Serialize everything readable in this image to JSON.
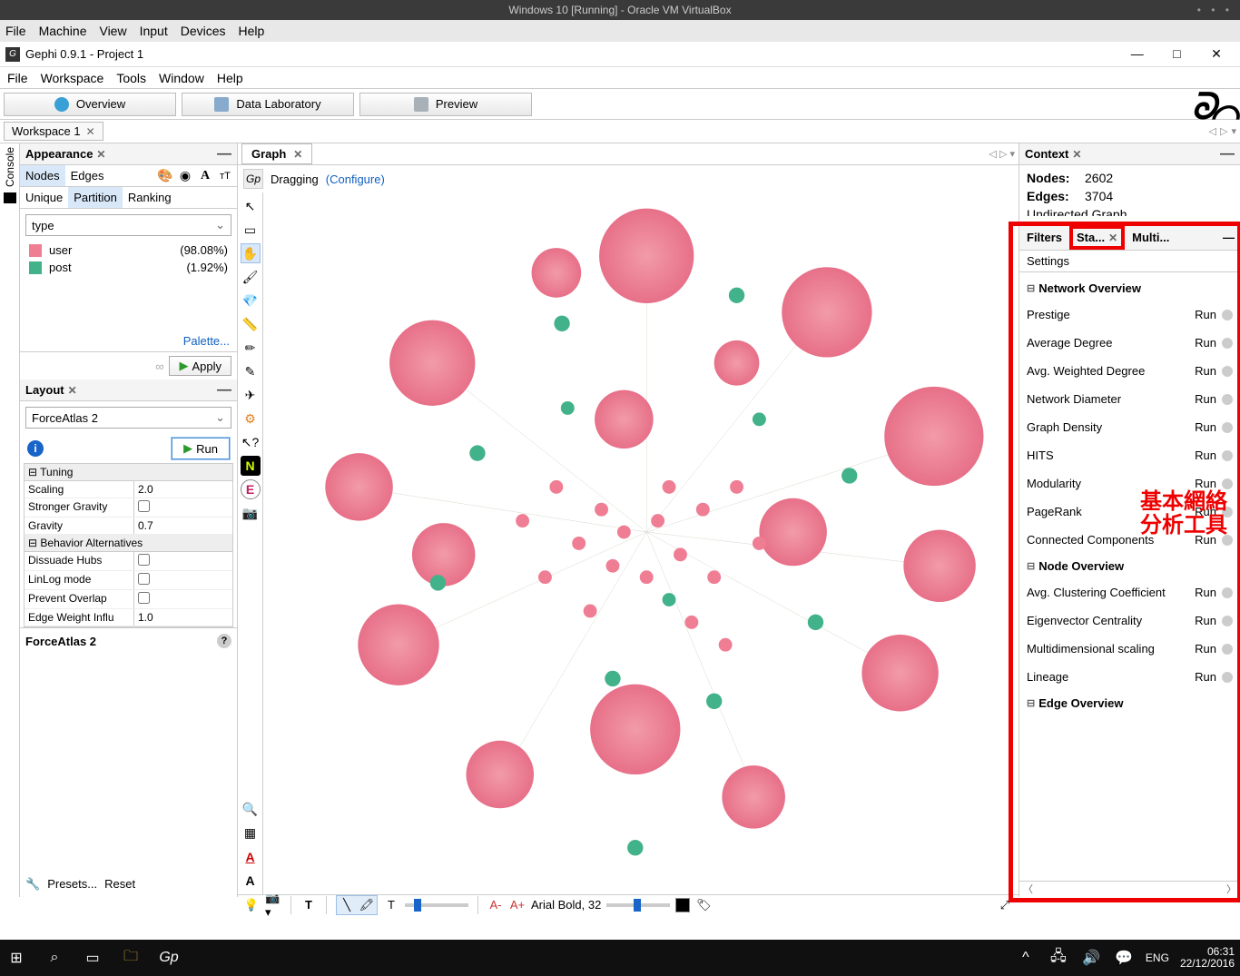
{
  "vb": {
    "title": "Windows 10 [Running] - Oracle VM VirtualBox",
    "menu": [
      "File",
      "Machine",
      "View",
      "Input",
      "Devices",
      "Help"
    ]
  },
  "win": {
    "title": "Gephi 0.9.1 - Project 1"
  },
  "gephi_menu": [
    "File",
    "Workspace",
    "Tools",
    "Window",
    "Help"
  ],
  "modes": {
    "overview": "Overview",
    "data_lab": "Data Laboratory",
    "preview": "Preview"
  },
  "workspace_tab": "Workspace 1",
  "console_label": "Console",
  "appearance": {
    "title": "Appearance",
    "tabs": {
      "nodes": "Nodes",
      "edges": "Edges"
    },
    "modes": {
      "unique": "Unique",
      "partition": "Partition",
      "ranking": "Ranking"
    },
    "attr_select": "type",
    "parts": [
      {
        "name": "user",
        "pct": "(98.08%)",
        "color": "#ef7e94"
      },
      {
        "name": "post",
        "pct": "(1.92%)",
        "color": "#41b28a"
      }
    ],
    "palette": "Palette...",
    "apply": "Apply"
  },
  "layout": {
    "title": "Layout",
    "algo": "ForceAtlas 2",
    "run": "Run",
    "groups": {
      "tuning": "Tuning",
      "behavior": "Behavior Alternatives"
    },
    "params": {
      "scaling_k": "Scaling",
      "scaling_v": "2.0",
      "stronger_k": "Stronger Gravity",
      "gravity_k": "Gravity",
      "gravity_v": "0.7",
      "dissuade_k": "Dissuade Hubs",
      "linlog_k": "LinLog mode",
      "prevent_k": "Prevent Overlap",
      "edge_k": "Edge Weight Influ",
      "edge_v": "1.0"
    },
    "footer": "ForceAtlas 2",
    "presets": "Presets...",
    "reset": "Reset"
  },
  "graph": {
    "tab": "Graph",
    "mode": "Dragging",
    "configure": "(Configure)",
    "font": "Arial Bold, 32"
  },
  "context": {
    "title": "Context",
    "nodes_k": "Nodes:",
    "nodes_v": "2602",
    "edges_k": "Edges:",
    "edges_v": "3704",
    "type": "Undirected Graph"
  },
  "right_tabs": {
    "filters": "Filters",
    "stats": "Sta...",
    "multi": "Multi..."
  },
  "settings": "Settings",
  "stats": {
    "network_overview": "Network Overview",
    "node_overview": "Node Overview",
    "edge_overview": "Edge Overview",
    "run": "Run",
    "items_net": [
      "Prestige",
      "Average Degree",
      "Avg. Weighted Degree",
      "Network Diameter",
      "Graph Density",
      "HITS",
      "Modularity",
      "PageRank",
      "Connected Components"
    ],
    "items_node": [
      "Avg. Clustering Coefficient",
      "Eigenvector Centrality",
      "Multidimensional scaling",
      "Lineage"
    ]
  },
  "annotation": "基本網絡\n分析工具",
  "taskbar": {
    "lang": "ENG",
    "time": "06:31",
    "date": "22/12/2016"
  }
}
